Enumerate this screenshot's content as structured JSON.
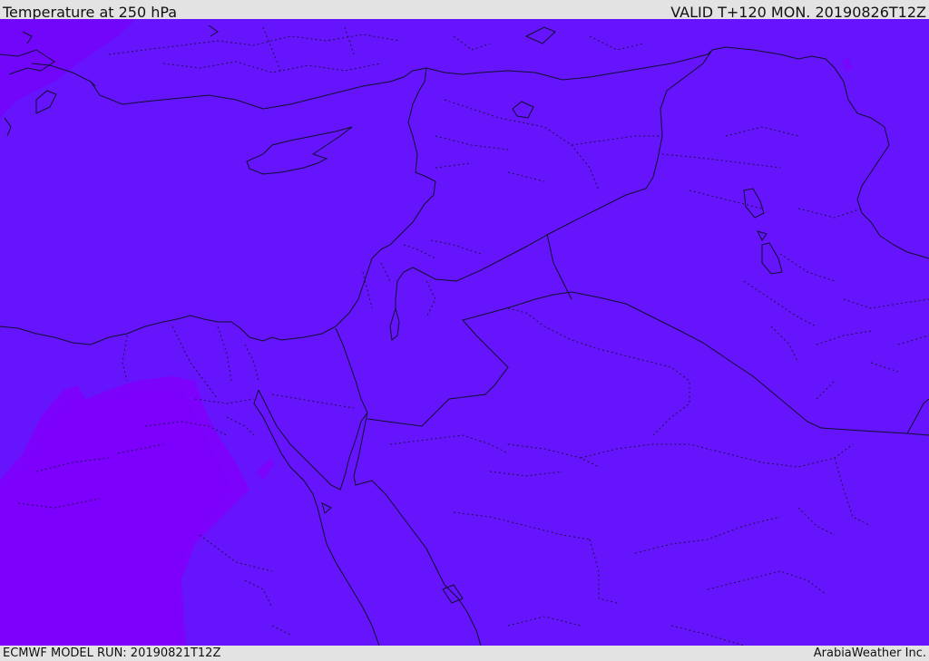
{
  "header": {
    "title": "Temperature at 250 hPa",
    "valid": "VALID T+120 MON. 20190826T12Z"
  },
  "footer": {
    "model_run": "ECMWF MODEL RUN: 20190821T12Z",
    "credit": "ArabiaWeather Inc."
  },
  "map": {
    "base_color": "#6514fb",
    "warm_color": "#7c00fc",
    "region": "Eastern Mediterranean / Middle East"
  }
}
